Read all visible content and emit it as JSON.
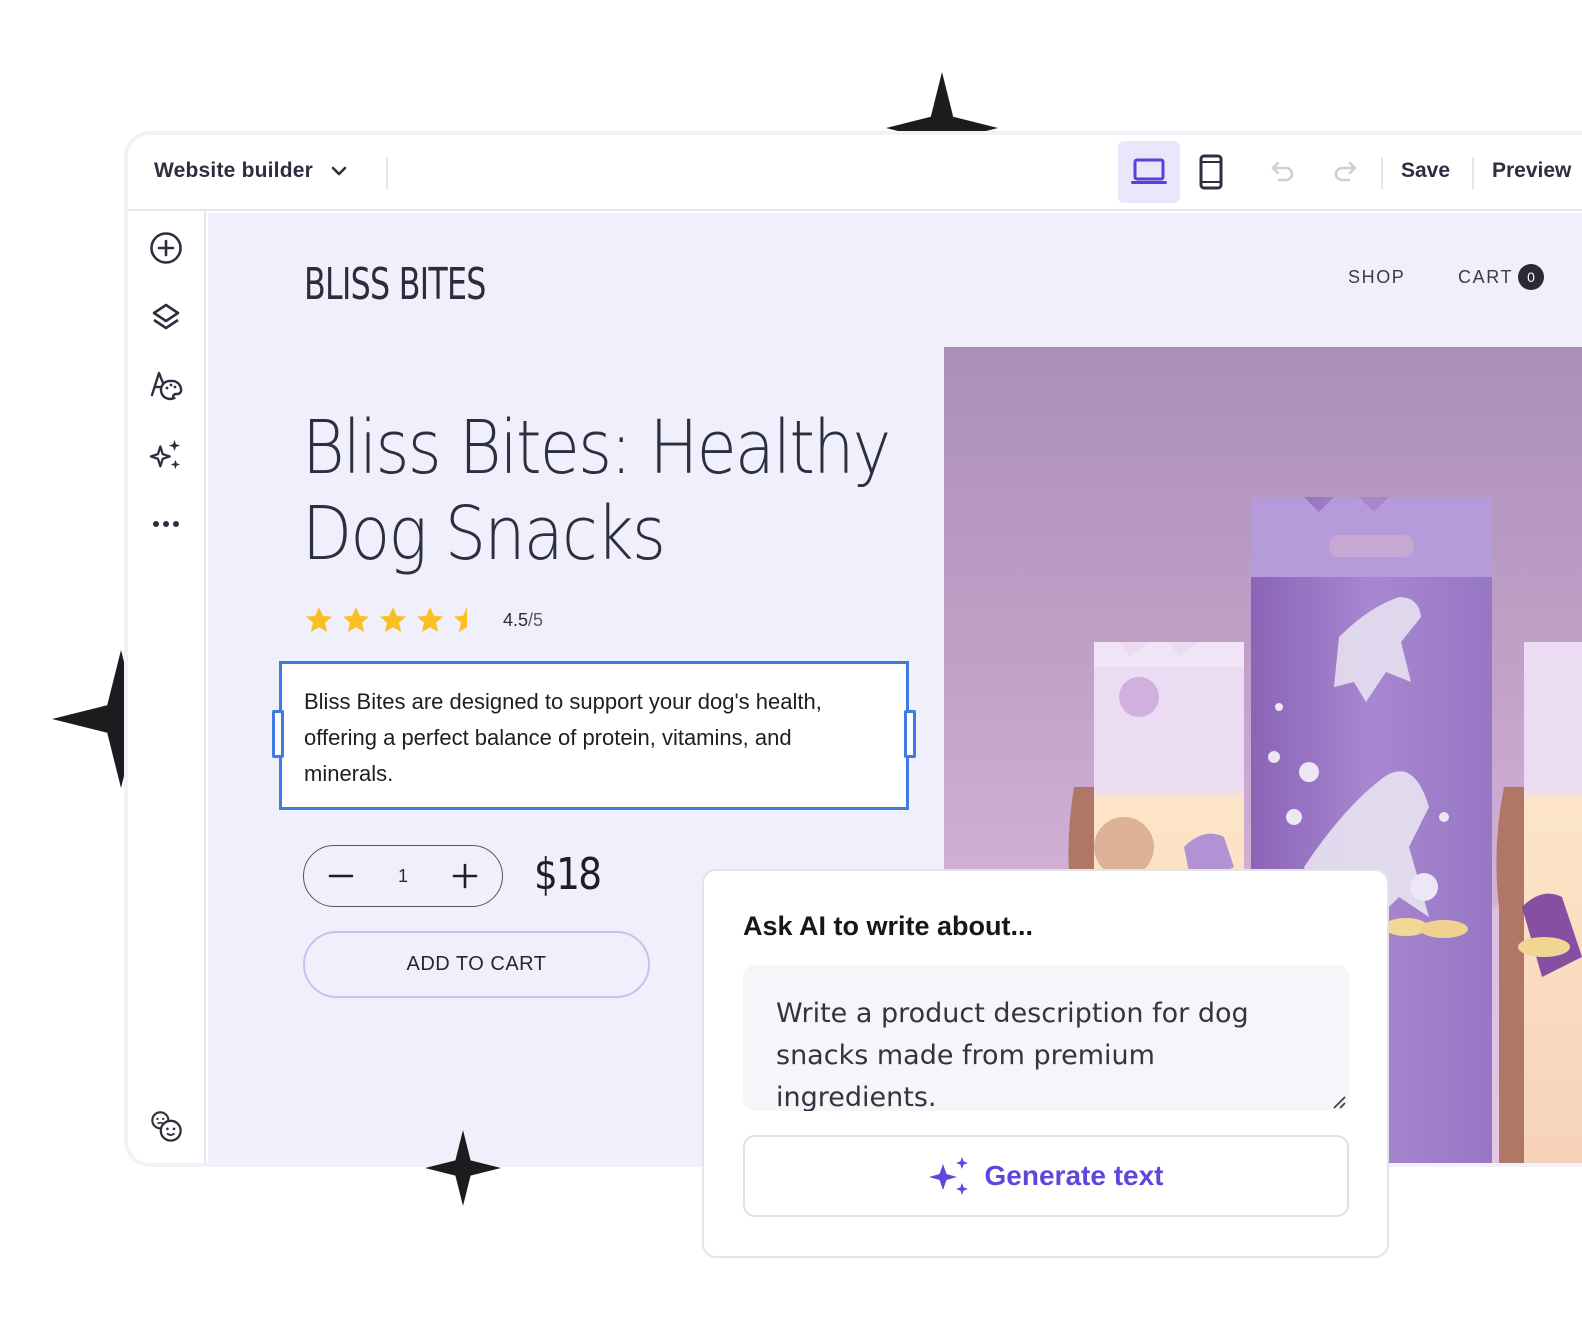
{
  "topbar": {
    "app_title": "Website builder",
    "save_label": "Save",
    "preview_label": "Preview",
    "devices": [
      {
        "name": "desktop",
        "active": true
      },
      {
        "name": "mobile",
        "active": false
      }
    ]
  },
  "rail": {
    "items": [
      "add-element",
      "layers",
      "theme-styles",
      "ai-assistant",
      "more"
    ],
    "bottom": "community-help"
  },
  "site": {
    "brand": "BLISS BITES",
    "nav": {
      "shop": "SHOP",
      "cart": "CART",
      "cart_count": "0"
    },
    "headline_line1": "Bliss Bites: Healthy",
    "headline_line2": "Dog Snacks",
    "rating": {
      "value": 4.5,
      "max": 5,
      "label_value": "4.5",
      "label_max": "/5"
    },
    "description": "Bliss Bites are designed to support your dog's health, offering a perfect balance of protein, vitamins, and minerals.",
    "quantity": "1",
    "price": "$18",
    "add_to_cart": "ADD TO CART",
    "image_alt": "Purple and cream dog snack pouches with treats on a pink surface"
  },
  "ai_panel": {
    "title": "Ask AI to write about...",
    "prompt_value": "Write a product description for dog snacks made from premium ingredients.",
    "generate_label": "Generate text"
  },
  "colors": {
    "accent": "#6145DC",
    "selection": "#3F7BE0",
    "canvas_bg": "#F0F0FC",
    "star": "#FBBF24",
    "device_active_bg": "#EBE6FB"
  }
}
